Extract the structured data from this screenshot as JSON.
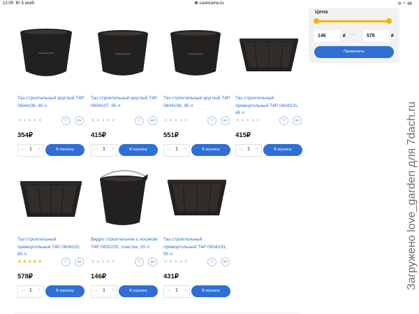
{
  "status_bar": {
    "time": "12:09",
    "date": "Вт 5 нояб.",
    "url": "castorama.ru",
    "battery": "66"
  },
  "filter": {
    "title": "Цена",
    "min_value": "146",
    "max_value": "578",
    "currency": "₽",
    "range_min_fraction": 0.0,
    "range_max_fraction": 1.0,
    "apply_label": "Применить"
  },
  "products": [
    {
      "title": "Таз строительный круглый Т4Р 0604106, 40 л",
      "price": "354₽",
      "qty": "1",
      "cart_label": "В корзину",
      "rating": "★★★★★",
      "rated": false,
      "compare_label": "Для срав."
    },
    {
      "title": "Таз строительный круглый Т4Р 0604107, 65 л",
      "price": "415₽",
      "qty": "1",
      "cart_label": "В корзину",
      "rating": "★★★★★",
      "rated": false,
      "compare_label": "Для срав."
    },
    {
      "title": "Таз строительный круглый Т4Р 0604108, 90 л",
      "price": "551₽",
      "qty": "1",
      "cart_label": "В корзину",
      "rating": "★★★★★",
      "rated": false,
      "compare_label": "Для срав."
    },
    {
      "title": "Таз строительный прямоугольный Т4Р 0604101, 45 л",
      "price": "415₽",
      "qty": "1",
      "cart_label": "В корзину",
      "rating": "★★★★★",
      "rated": false,
      "compare_label": "Для срав."
    },
    {
      "title": "Таз строительный прямоугольный Т4Р 0604102, 60 л",
      "price": "578₽",
      "qty": "1",
      "cart_label": "В корзину",
      "rating": "★★★★★",
      "rated": true,
      "compare_label": "Для срав."
    },
    {
      "title": "Ведро строительное с носиком Т4Р 0602220, пластик, 20 л",
      "price": "146₽",
      "qty": "1",
      "cart_label": "В корзину",
      "rating": "★★★★★",
      "rated": false,
      "compare_label": "Для срав."
    },
    {
      "title": "Таз строительный прямоугольный Т4Р 0604103, 90 л",
      "price": "431₽",
      "qty": "1",
      "cart_label": "В корзину",
      "rating": "★★★★★",
      "rated": false,
      "compare_label": "Для срав."
    }
  ],
  "icons": {
    "favorite": "heart-icon",
    "compare": "compare-icon",
    "minus": "minus-icon",
    "plus": "plus-icon"
  },
  "colors": {
    "link": "#2e6fc8",
    "button": "#2f6fd6",
    "accent": "#f2b500",
    "product": "#232120"
  },
  "watermark": "Загружено love_garden для 7dach.ru"
}
